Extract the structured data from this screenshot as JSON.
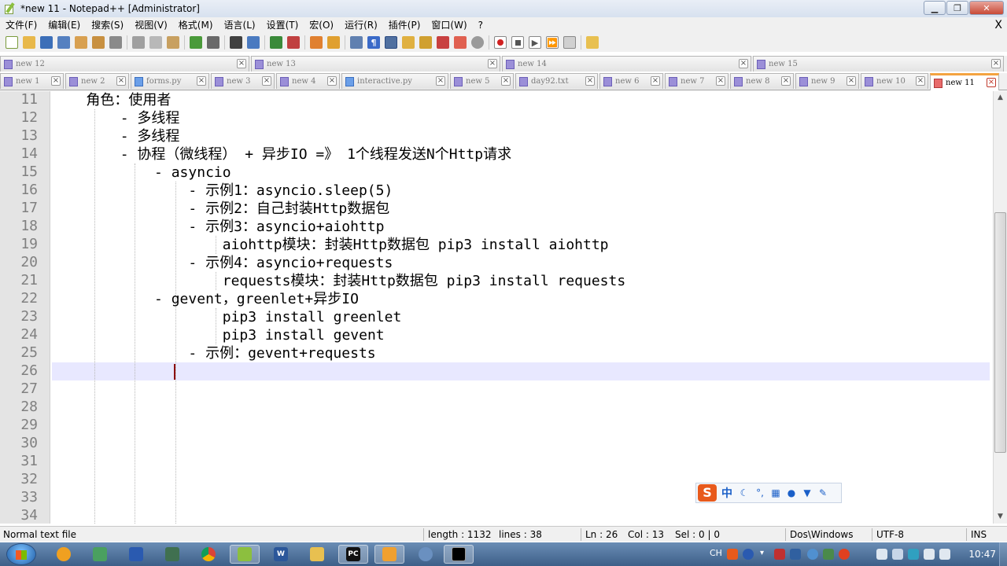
{
  "window": {
    "title": "*new 11 - Notepad++ [Administrator]"
  },
  "menu": [
    "文件(F)",
    "编辑(E)",
    "搜索(S)",
    "视图(V)",
    "格式(M)",
    "语言(L)",
    "设置(T)",
    "宏(O)",
    "运行(R)",
    "插件(P)",
    "窗口(W)",
    "?"
  ],
  "menu_close": "X",
  "tabs_row1": [
    {
      "label": "new 12",
      "type": "txt"
    },
    {
      "label": "new 13",
      "type": "txt"
    },
    {
      "label": "new 14",
      "type": "txt"
    },
    {
      "label": "new 15",
      "type": "txt"
    }
  ],
  "tabs_row2": [
    {
      "label": "new 1",
      "type": "txt"
    },
    {
      "label": "new 2",
      "type": "txt"
    },
    {
      "label": "forms.py",
      "type": "py"
    },
    {
      "label": "new 3",
      "type": "txt"
    },
    {
      "label": "new 4",
      "type": "txt"
    },
    {
      "label": "interactive.py",
      "type": "py"
    },
    {
      "label": "new 5",
      "type": "txt"
    },
    {
      "label": "day92.txt",
      "type": "txt"
    },
    {
      "label": "new 6",
      "type": "txt"
    },
    {
      "label": "new 7",
      "type": "txt"
    },
    {
      "label": "new 8",
      "type": "txt"
    },
    {
      "label": "new 9",
      "type": "txt"
    },
    {
      "label": "new 10",
      "type": "txt"
    },
    {
      "label": "new 11",
      "type": "active"
    }
  ],
  "tab_close": "×",
  "editor": {
    "lines": [
      {
        "num": "11",
        "text": "    角色：使用者"
      },
      {
        "num": "12",
        "text": "        - 多线程"
      },
      {
        "num": "13",
        "text": "        - 多线程"
      },
      {
        "num": "14",
        "text": "        - 协程（微线程） + 异步IO =》 1个线程发送N个Http请求"
      },
      {
        "num": "15",
        "text": "            - asyncio"
      },
      {
        "num": "16",
        "text": "                - 示例1：asyncio.sleep(5)"
      },
      {
        "num": "17",
        "text": "                - 示例2：自己封装Http数据包"
      },
      {
        "num": "18",
        "text": "                - 示例3：asyncio+aiohttp"
      },
      {
        "num": "19",
        "text": "                    aiohttp模块：封装Http数据包 pip3 install aiohttp"
      },
      {
        "num": "20",
        "text": "                - 示例4：asyncio+requests"
      },
      {
        "num": "21",
        "text": "                    requests模块：封装Http数据包 pip3 install requests"
      },
      {
        "num": "22",
        "text": "            - gevent，greenlet+异步IO"
      },
      {
        "num": "23",
        "text": "                    pip3 install greenlet"
      },
      {
        "num": "24",
        "text": "                    pip3 install gevent"
      },
      {
        "num": "25",
        "text": "                - 示例：gevent+requests"
      },
      {
        "num": "26",
        "text": ""
      },
      {
        "num": "27",
        "text": ""
      },
      {
        "num": "28",
        "text": ""
      },
      {
        "num": "29",
        "text": ""
      },
      {
        "num": "30",
        "text": ""
      },
      {
        "num": "31",
        "text": ""
      },
      {
        "num": "32",
        "text": ""
      },
      {
        "num": "33",
        "text": ""
      },
      {
        "num": "34",
        "text": ""
      }
    ]
  },
  "ime": {
    "logo": "S",
    "mode": "中"
  },
  "status": {
    "filetype": "Normal text file",
    "length": "length : 1132",
    "lines": "lines : 38",
    "ln": "Ln : 26",
    "col": "Col : 13",
    "sel": "Sel : 0 | 0",
    "eol": "Dos\\Windows",
    "encoding": "UTF-8",
    "mode": "INS"
  },
  "taskbar": {
    "tray_ime": "CH",
    "clock": "10:47"
  }
}
